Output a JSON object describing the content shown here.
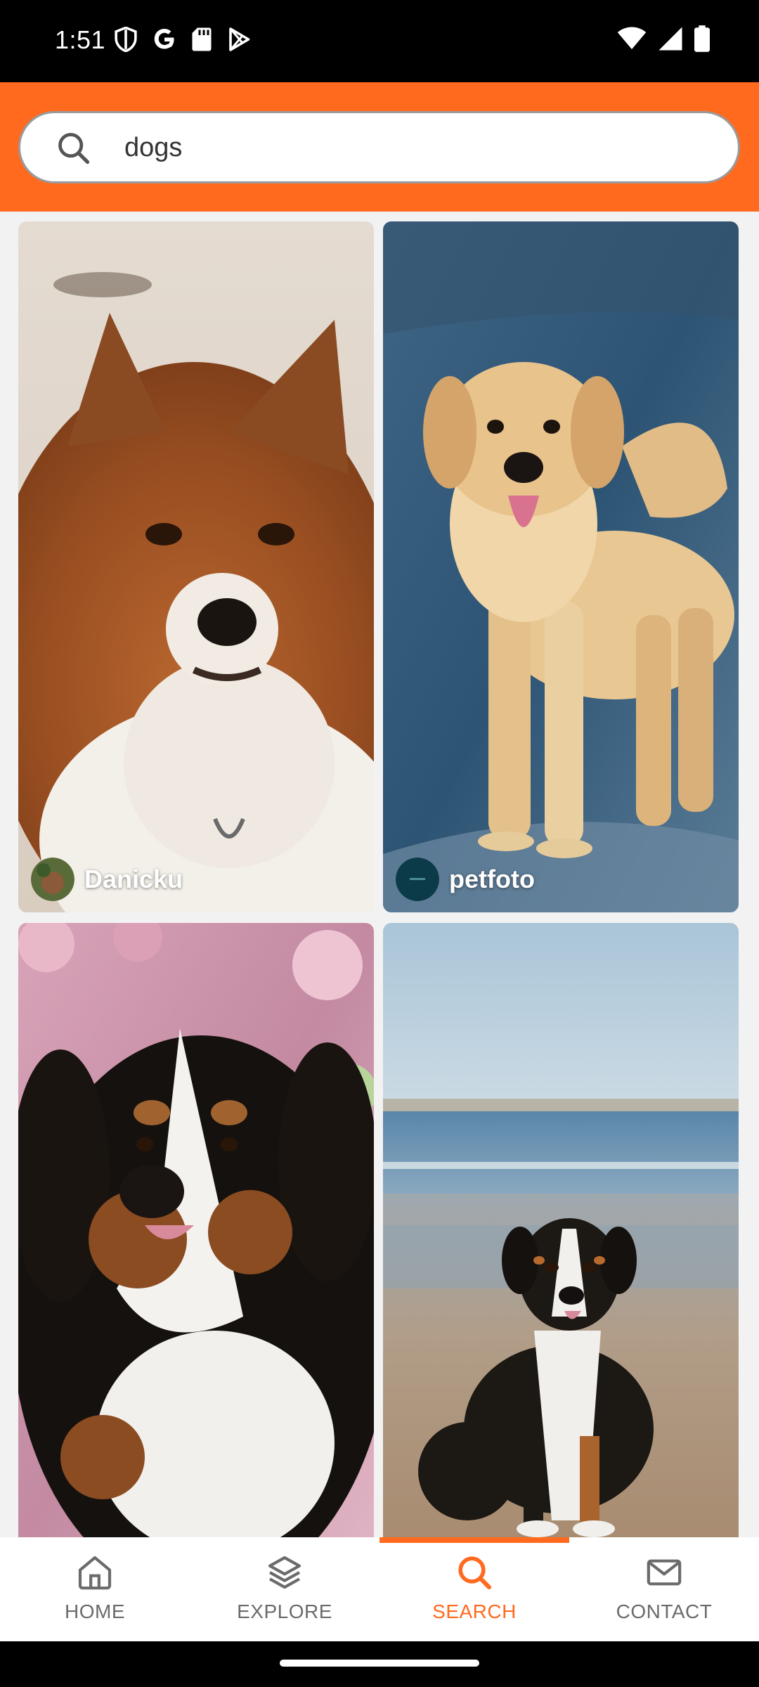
{
  "status_bar": {
    "time": "1:51",
    "left_icons": [
      "shield-icon",
      "google-icon",
      "sd-card-icon",
      "play-store-icon"
    ],
    "right_icons": [
      "wifi-icon",
      "signal-icon",
      "battery-icon"
    ]
  },
  "search": {
    "query": "dogs",
    "icon": "search-icon"
  },
  "colors": {
    "accent": "#FF6A1F",
    "nav_inactive": "#6b6b6b",
    "grid_bg": "#f2f2f2"
  },
  "results": [
    {
      "author": "Danicku",
      "subject": "sheltie dog portrait"
    },
    {
      "author": "petfoto",
      "subject": "golden retriever on blue backdrop"
    },
    {
      "author": "",
      "subject": "bernese mountain dog in blossoms"
    },
    {
      "author": "",
      "subject": "appenzeller dog sitting on beach"
    }
  ],
  "bottom_nav": {
    "items": [
      {
        "label": "HOME",
        "icon": "home-icon",
        "active": false
      },
      {
        "label": "EXPLORE",
        "icon": "layers-icon",
        "active": false
      },
      {
        "label": "SEARCH",
        "icon": "search-icon",
        "active": true
      },
      {
        "label": "CONTACT",
        "icon": "mail-icon",
        "active": false
      }
    ]
  }
}
